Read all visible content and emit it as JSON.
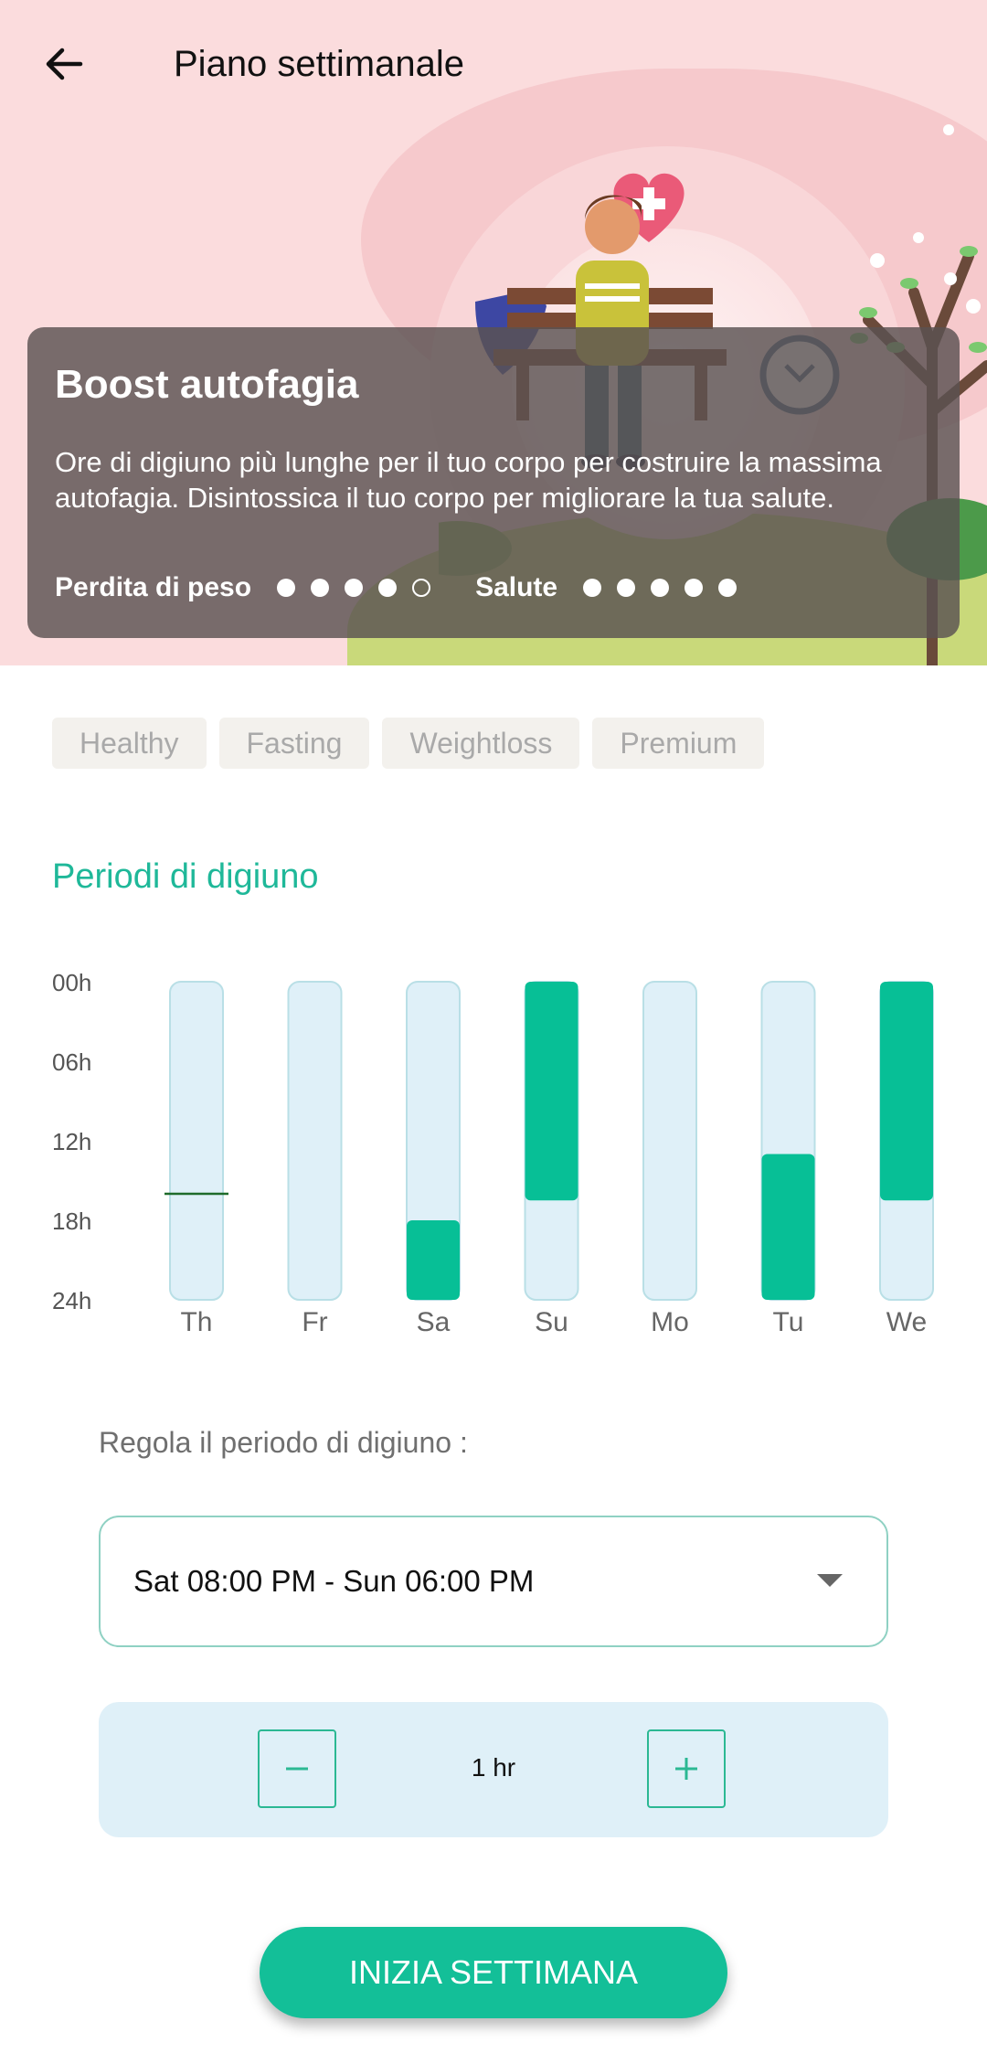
{
  "header": {
    "title": "Piano settimanale",
    "back_icon": "arrow-left-icon"
  },
  "plan_card": {
    "title": "Boost autofagia",
    "description": "Ore di digiuno più lunghe per il tuo corpo per costruire la massima autofagia. Disintossica il tuo corpo per migliorare la tua salute.",
    "weight_loss_label": "Perdita di peso",
    "weight_loss_rating": 4,
    "health_label": "Salute",
    "health_rating": 5,
    "rating_max": 5
  },
  "tags": [
    "Healthy",
    "Fasting",
    "Weightloss",
    "Premium"
  ],
  "section": {
    "title": "Periodi di digiuno"
  },
  "chart_data": {
    "type": "bar",
    "categories": [
      "Th",
      "Fr",
      "Sa",
      "Su",
      "Mo",
      "Tu",
      "We"
    ],
    "y_ticks": [
      "00h",
      "06h",
      "12h",
      "18h",
      "24h"
    ],
    "ylim": [
      0,
      24
    ],
    "fasting_ranges_hours": [
      null,
      null,
      [
        18,
        24
      ],
      [
        0,
        16.5
      ],
      null,
      [
        13,
        24
      ],
      [
        0,
        16.5
      ]
    ],
    "current_time_marker": {
      "day": "Th",
      "hour": 16
    },
    "colors": {
      "track": "#dff0f8",
      "track_border": "#b9dfe6",
      "fill": "#07bf96",
      "marker": "#1e6b2a"
    }
  },
  "adjust": {
    "label": "Regola il periodo di digiuno :",
    "selected_period": "Sat 08:00 PM - Sun 06:00 PM",
    "dropdown_icon": "caret-down-icon"
  },
  "stepper": {
    "value": "1 hr",
    "minus_icon": "minus-icon",
    "plus_icon": "plus-icon"
  },
  "cta": {
    "label": "INIZIA SETTIMANA"
  },
  "colors": {
    "accent": "#13bf98",
    "hero_bg": "#fbdcdd"
  }
}
